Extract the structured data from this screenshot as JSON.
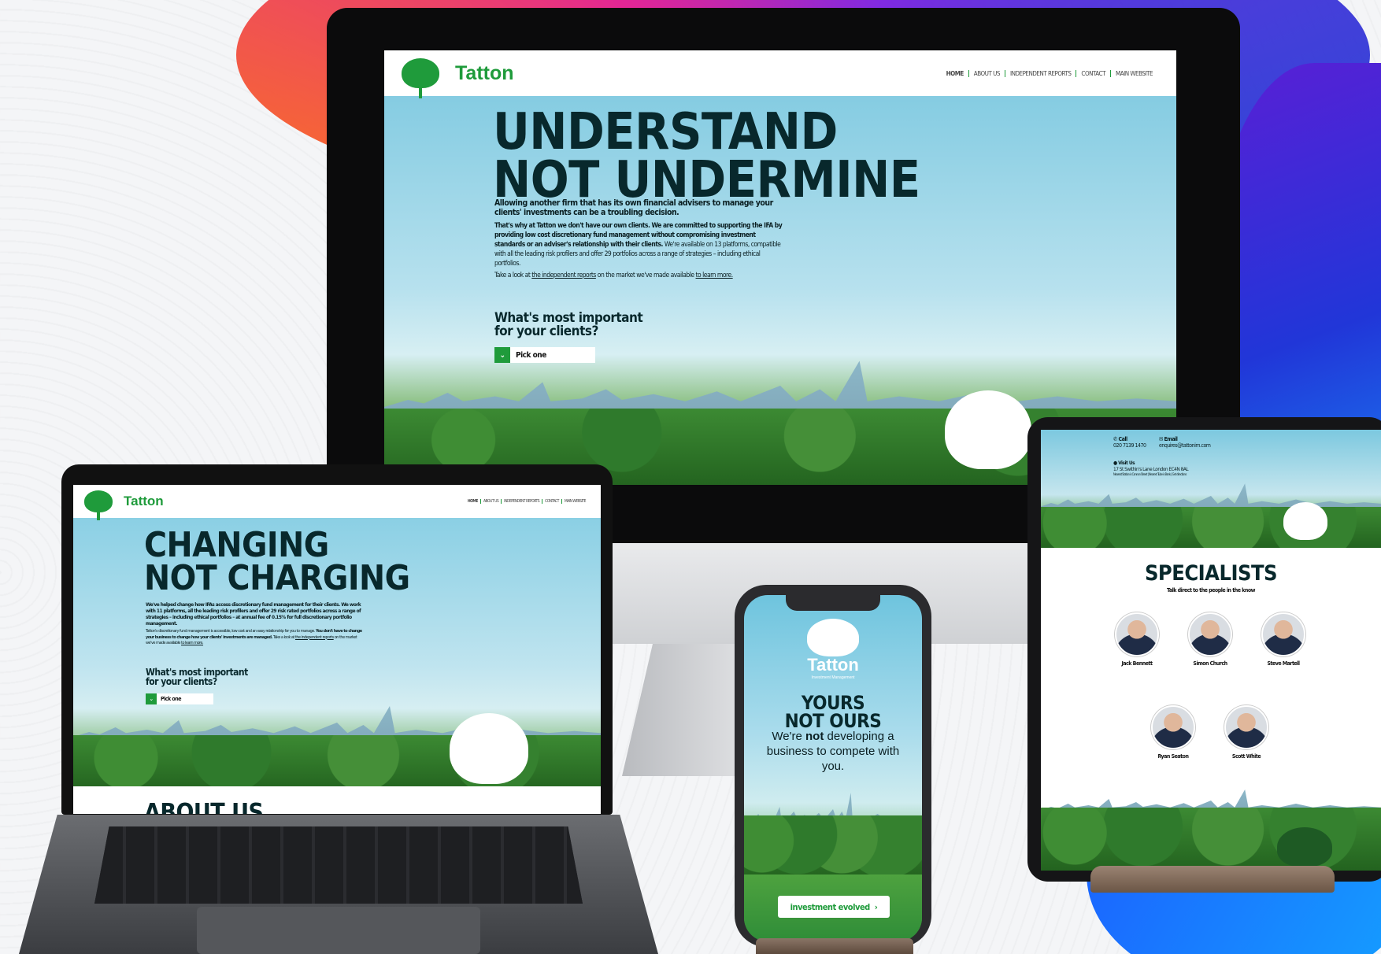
{
  "brand": {
    "name": "Tatton",
    "color": "#1f9b3b",
    "ink": "#08282c"
  },
  "nav": [
    "HOME",
    "ABOUT US",
    "INDEPENDENT REPORTS",
    "CONTACT",
    "MAIN WEBSITE"
  ],
  "desktop": {
    "headline_1": "UNDERSTAND",
    "headline_2": "NOT UNDERMINE",
    "lead": "Allowing another firm that has its own financial advisers to manage your clients' investments can be a troubling decision.",
    "body_bold": "That's why at Tatton we don't have our own clients. We are committed to supporting the IFA by providing low cost discretionary fund management without compromising investment standards or an adviser's relationship with their clients.",
    "body_rest": " We're available on 13 platforms, compatible with all the leading risk profilers and offer 29 portfolios across a range of strategies – including ethical portfolios.",
    "look_prefix": "Take a look at ",
    "look_link": "the independent reports",
    "look_mid": " on the market we've made available ",
    "look_more": "to learn more.",
    "question_1": "What's most important",
    "question_2": "for your clients?",
    "pick": "Pick one"
  },
  "laptop": {
    "headline_1": "CHANGING",
    "headline_2": "NOT CHARGING",
    "lead": "We've helped change how IFAs access discretionary fund management for their clients. We work with 11 platforms, all the leading risk profilers and offer 29 risk rated portfolios across a range of strategies – including ethical portfolios – at annual fee of 0.15% for full discretionary portfolio management.",
    "body_1": "Tatton's discretionary fund management is accessible, low cost and an easy relationship for you to manage. ",
    "body_bold": "You don't have to change your business to change how your clients' investments are managed.",
    "body_2": " Take a look at ",
    "body_link": "the independent reports",
    "body_3": " on the market we've made available ",
    "body_more": "to learn more.",
    "question_1": "What's most important",
    "question_2": "for your clients?",
    "pick": "Pick one",
    "next_section": "ABOUT US"
  },
  "phone": {
    "brand": "Tatton",
    "tagline": "Investment Management",
    "headline_1": "YOURS",
    "headline_2": "NOT OURS",
    "body_1": "We're ",
    "body_bold": "not",
    "body_2": " developing a business to compete with you.",
    "cta": "investment evolved"
  },
  "tablet": {
    "call_label": "Call",
    "call_value": "020 7139 1470",
    "email_label": "Email",
    "email_value": "enquires@tattonim.com",
    "visit_label": "Visit Us",
    "visit_value": "17 St Swithin's Lane London EC4N 8AL",
    "visit_note": "Nearest Station is Cannon Street | Nearest Tube is Bank | Get directions",
    "title": "SPECIALISTS",
    "subtitle": "Talk direct to the people in the know",
    "people": [
      {
        "name": "Jack Bennett"
      },
      {
        "name": "Simon Church"
      },
      {
        "name": "Steve Martell"
      },
      {
        "name": "Ryan Seaton"
      },
      {
        "name": "Scott White"
      }
    ]
  }
}
